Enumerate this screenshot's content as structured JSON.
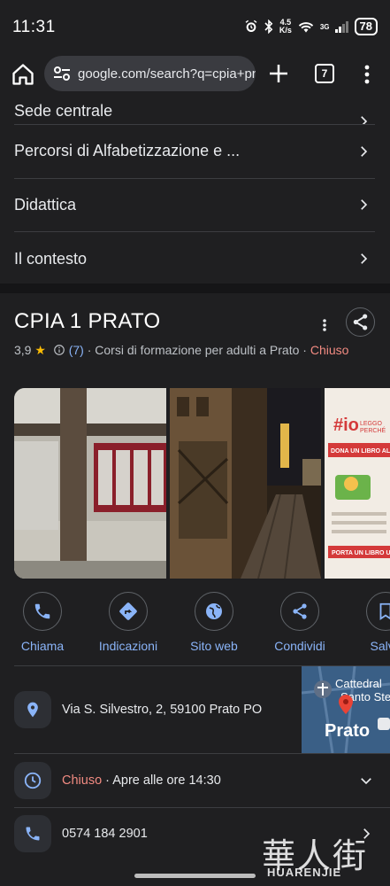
{
  "status_bar": {
    "time": "11:31",
    "net_speed_value": "4.5",
    "net_speed_unit": "K/s",
    "signal_label": "3G",
    "battery": "78"
  },
  "browser": {
    "url": "google.com/search?q=cpia+pra",
    "tab_count": "7"
  },
  "menu_list": {
    "items": [
      {
        "label": "Sede centrale"
      },
      {
        "label": "Percorsi di Alfabetizzazione e ..."
      },
      {
        "label": "Didattica"
      },
      {
        "label": "Il contesto"
      }
    ]
  },
  "place": {
    "title": "CPIA 1 PRATO",
    "rating": "3,9",
    "star": "★",
    "review_count": "(7)",
    "category": "Corsi di formazione per adulti a Prato",
    "status": "Chiuso",
    "separator": "·"
  },
  "actions": [
    {
      "label": "Chiama",
      "icon": "phone-icon"
    },
    {
      "label": "Indicazioni",
      "icon": "directions-icon"
    },
    {
      "label": "Sito web",
      "icon": "globe-icon"
    },
    {
      "label": "Condividi",
      "icon": "share-icon"
    },
    {
      "label": "Salva",
      "icon": "bookmark-icon"
    }
  ],
  "info": {
    "address": "Via S. Silvestro, 2, 59100 Prato PO",
    "hours_status": "Chiuso",
    "hours_detail": " · Apre alle ore 14:30",
    "phone": "0574 184 2901"
  },
  "map": {
    "label_city": "Prato",
    "label_church": "Cattedrale di Santo Stefano"
  },
  "photos": {
    "poster_title": "#ioLEGGOPERCHÉ",
    "poster_line": "DONA UN LIBRO ALLE DI",
    "poster_footer": "PORTA UN LIBRO US"
  },
  "watermark": {
    "cn": "華人街",
    "en": "HUARENJIE"
  },
  "colors": {
    "background": "#1f1f21",
    "accent_blue": "#8ab4f8",
    "closed_red": "#f28b82",
    "star_yellow": "#fbbc04"
  }
}
